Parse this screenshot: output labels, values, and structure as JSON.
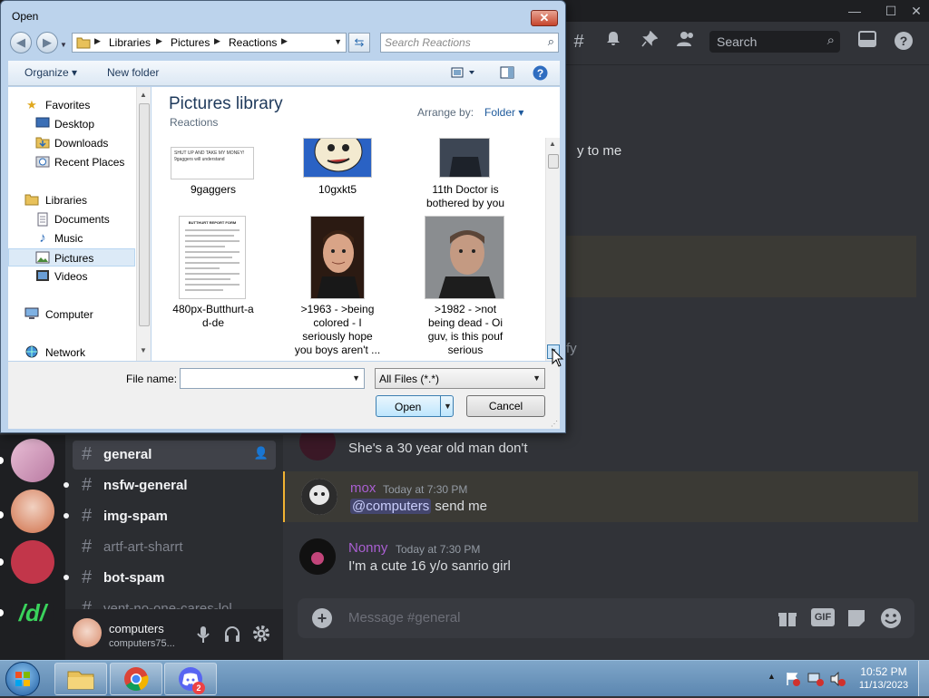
{
  "discord": {
    "window_controls": {
      "minimize": "—",
      "maximize": "☐",
      "close": "✕"
    },
    "header": {
      "search_placeholder": "Search"
    },
    "partial_text_1": "y to me",
    "partial_text_2": "fy",
    "channels": [
      {
        "name": "general",
        "active": true
      },
      {
        "name": "nsfw-general"
      },
      {
        "name": "img-spam"
      },
      {
        "name": "artf-art-sharrt",
        "muted": true
      },
      {
        "name": "bot-spam"
      },
      {
        "name": "vent-no-one-cares-lol",
        "muted": true
      }
    ],
    "guild_letters": "/d/",
    "user": {
      "name": "computers",
      "status": "computers75..."
    },
    "messages": [
      {
        "text": "She's a 30 year old man don't"
      },
      {
        "author": "mox",
        "timestamp": "Today at 7:30 PM",
        "mention": "@computers",
        "text": " send me"
      },
      {
        "author": "Nonny",
        "timestamp": "Today at 7:30 PM",
        "text": "I'm a cute 16 y/o sanrio girl"
      }
    ],
    "composer_placeholder": "Message #general",
    "gif_label": "GIF",
    "accent_color": "#5865f2",
    "author_color": "#a95fd1"
  },
  "taskbar": {
    "time": "10:52 PM",
    "date": "11/13/2023",
    "discord_badge": "2"
  },
  "dialog": {
    "title": "Open",
    "close": "✕",
    "breadcrumb": [
      "Libraries",
      "Pictures",
      "Reactions"
    ],
    "search_placeholder": "Search Reactions",
    "toolbar": {
      "organize": "Organize",
      "new_folder": "New folder"
    },
    "nav": {
      "favorites": "Favorites",
      "desktop": "Desktop",
      "downloads": "Downloads",
      "recent": "Recent Places",
      "libraries": "Libraries",
      "documents": "Documents",
      "music": "Music",
      "pictures": "Pictures",
      "videos": "Videos",
      "computer": "Computer",
      "network": "Network"
    },
    "library_title": "Pictures library",
    "library_subtitle": "Reactions",
    "arrange_by": "Arrange by:",
    "arrange_value": "Folder",
    "files": [
      {
        "caption": "9gaggers",
        "thumb_text": "SHUT UP AND TAKE MY MONEY!\n9gaggers will understand"
      },
      {
        "caption": "10gxkt5"
      },
      {
        "caption": "11th Doctor is\nbothered by you"
      },
      {
        "caption": "480px-Butthurt-a\nd-de",
        "thumb_text": "BUTTHURT REPORT FORM"
      },
      {
        "caption": ">1963 - >being\ncolored - I\nseriously hope\nyou boys aren't ..."
      },
      {
        "caption": ">1982 - >not\nbeing dead - Oi\nguv, is this pouf\nserious"
      }
    ],
    "file_name_label": "File name:",
    "file_name_value": "",
    "file_type": "All Files (*.*)",
    "open_button": "Open",
    "cancel_button": "Cancel"
  }
}
